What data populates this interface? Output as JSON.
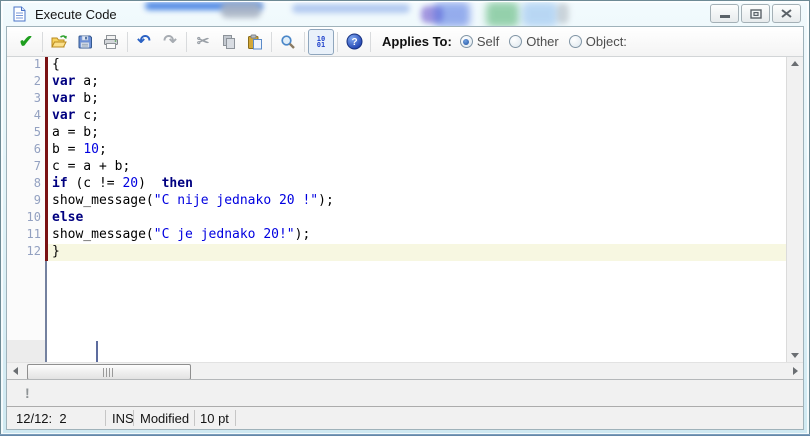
{
  "window": {
    "title": "Execute Code"
  },
  "toolbar": {
    "buttons": [
      {
        "name": "validate",
        "icon": "check-icon",
        "enabled": true
      },
      {
        "name": "open",
        "icon": "open-folder-icon",
        "enabled": true
      },
      {
        "name": "save",
        "icon": "save-icon",
        "enabled": true
      },
      {
        "name": "print",
        "icon": "print-icon",
        "enabled": true
      },
      {
        "name": "undo",
        "icon": "undo-icon",
        "enabled": true
      },
      {
        "name": "redo",
        "icon": "redo-icon",
        "enabled": false
      },
      {
        "name": "cut",
        "icon": "cut-icon",
        "enabled": false
      },
      {
        "name": "copy",
        "icon": "copy-icon",
        "enabled": false
      },
      {
        "name": "paste",
        "icon": "paste-icon",
        "enabled": true
      },
      {
        "name": "find",
        "icon": "search-icon",
        "enabled": true
      },
      {
        "name": "toggle-binary-view",
        "icon": "binary-icon",
        "enabled": true,
        "pressed": true
      },
      {
        "name": "help",
        "icon": "help-icon",
        "enabled": true
      }
    ],
    "binary_icon": {
      "top": "10",
      "bottom": "01"
    },
    "check_glyph": "✔",
    "undo_glyph": "↶",
    "redo_glyph": "↷",
    "cut_glyph": "✂",
    "applies_to_label": "Applies To:",
    "radios": [
      {
        "label": "Self",
        "checked": true
      },
      {
        "label": "Other",
        "checked": false
      },
      {
        "label": "Object:",
        "checked": false
      }
    ]
  },
  "editor": {
    "current_line": 12,
    "lines": [
      [
        {
          "t": "{",
          "c": "p"
        }
      ],
      [
        {
          "t": "var",
          "c": "k"
        },
        {
          "t": " a;",
          "c": "p"
        }
      ],
      [
        {
          "t": "var",
          "c": "k"
        },
        {
          "t": " b;",
          "c": "p"
        }
      ],
      [
        {
          "t": "var",
          "c": "k"
        },
        {
          "t": " c;",
          "c": "p"
        }
      ],
      [
        {
          "t": "a = b;",
          "c": "p"
        }
      ],
      [
        {
          "t": "b = ",
          "c": "p"
        },
        {
          "t": "10",
          "c": "n"
        },
        {
          "t": ";",
          "c": "p"
        }
      ],
      [
        {
          "t": "c = a + b;",
          "c": "p"
        }
      ],
      [
        {
          "t": "if",
          "c": "k"
        },
        {
          "t": " (c != ",
          "c": "p"
        },
        {
          "t": "20",
          "c": "n"
        },
        {
          "t": ")  ",
          "c": "p"
        },
        {
          "t": "then",
          "c": "k"
        }
      ],
      [
        {
          "t": "show_message(",
          "c": "p"
        },
        {
          "t": "\"C nije jednako 20 !\"",
          "c": "s"
        },
        {
          "t": ");",
          "c": "p"
        }
      ],
      [
        {
          "t": "else",
          "c": "k"
        }
      ],
      [
        {
          "t": "show_message(",
          "c": "p"
        },
        {
          "t": "\"C je jednako 20!\"",
          "c": "s"
        },
        {
          "t": ");",
          "c": "p"
        }
      ],
      [
        {
          "t": "}",
          "c": "p"
        }
      ]
    ]
  },
  "message_panel": {
    "text": "!"
  },
  "status_bar": {
    "cursor_position": "12/12:  2",
    "insert_mode": "INS",
    "modified_state": "Modified",
    "font_size": "10 pt"
  },
  "colors": {
    "kw": "#000080",
    "num": "#0000e0",
    "str": "#0000e0",
    "lineno": "#93a1c1",
    "marbar": "#7a1113",
    "curline": "#f7f7e1"
  }
}
